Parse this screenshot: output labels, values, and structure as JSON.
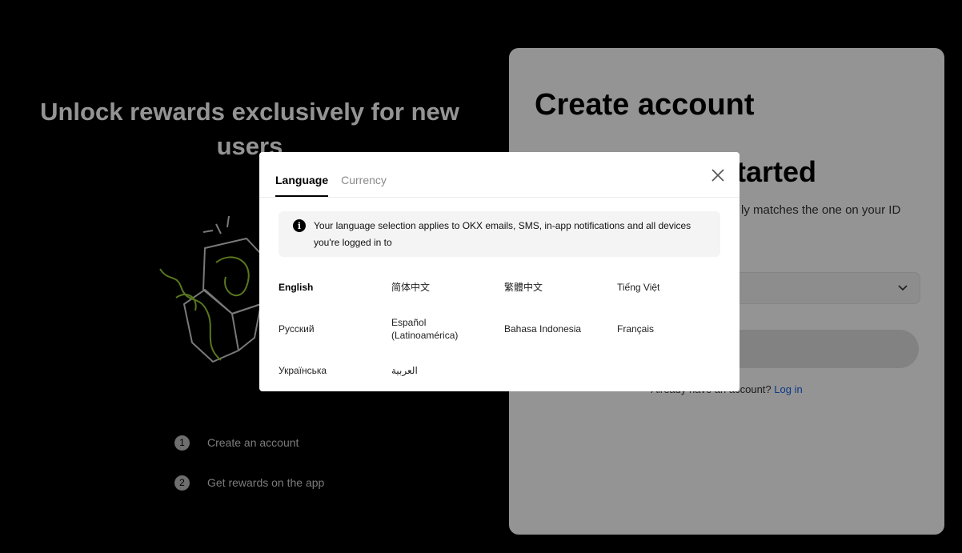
{
  "promo": {
    "title": "Unlock rewards exclusively for new users",
    "steps": [
      {
        "num": "1",
        "label": "Create an account"
      },
      {
        "num": "2",
        "label": "Get rewards on the app"
      }
    ]
  },
  "card": {
    "title": "Create account",
    "subtitle_visible": "started",
    "hint_visible": "ly matches the one on your ID",
    "login_prompt_visible": "Already have an account?",
    "login_link": "Log in"
  },
  "modal": {
    "tabs": [
      {
        "label": "Language",
        "active": true
      },
      {
        "label": "Currency",
        "active": false
      }
    ],
    "notice": "Your language selection applies to OKX emails, SMS, in-app notifications and all devices you're logged in to",
    "languages": [
      [
        "English",
        "简体中文",
        "繁體中文",
        "Tiếng Việt"
      ],
      [
        "Русский",
        "Español (Latinoamérica)",
        "Bahasa Indonesia",
        "Français"
      ],
      [
        "Українська",
        "العربية"
      ]
    ],
    "selected_language": "English"
  },
  "colors": {
    "accent_link": "#1662e8",
    "illustration_green": "#9acd32"
  }
}
